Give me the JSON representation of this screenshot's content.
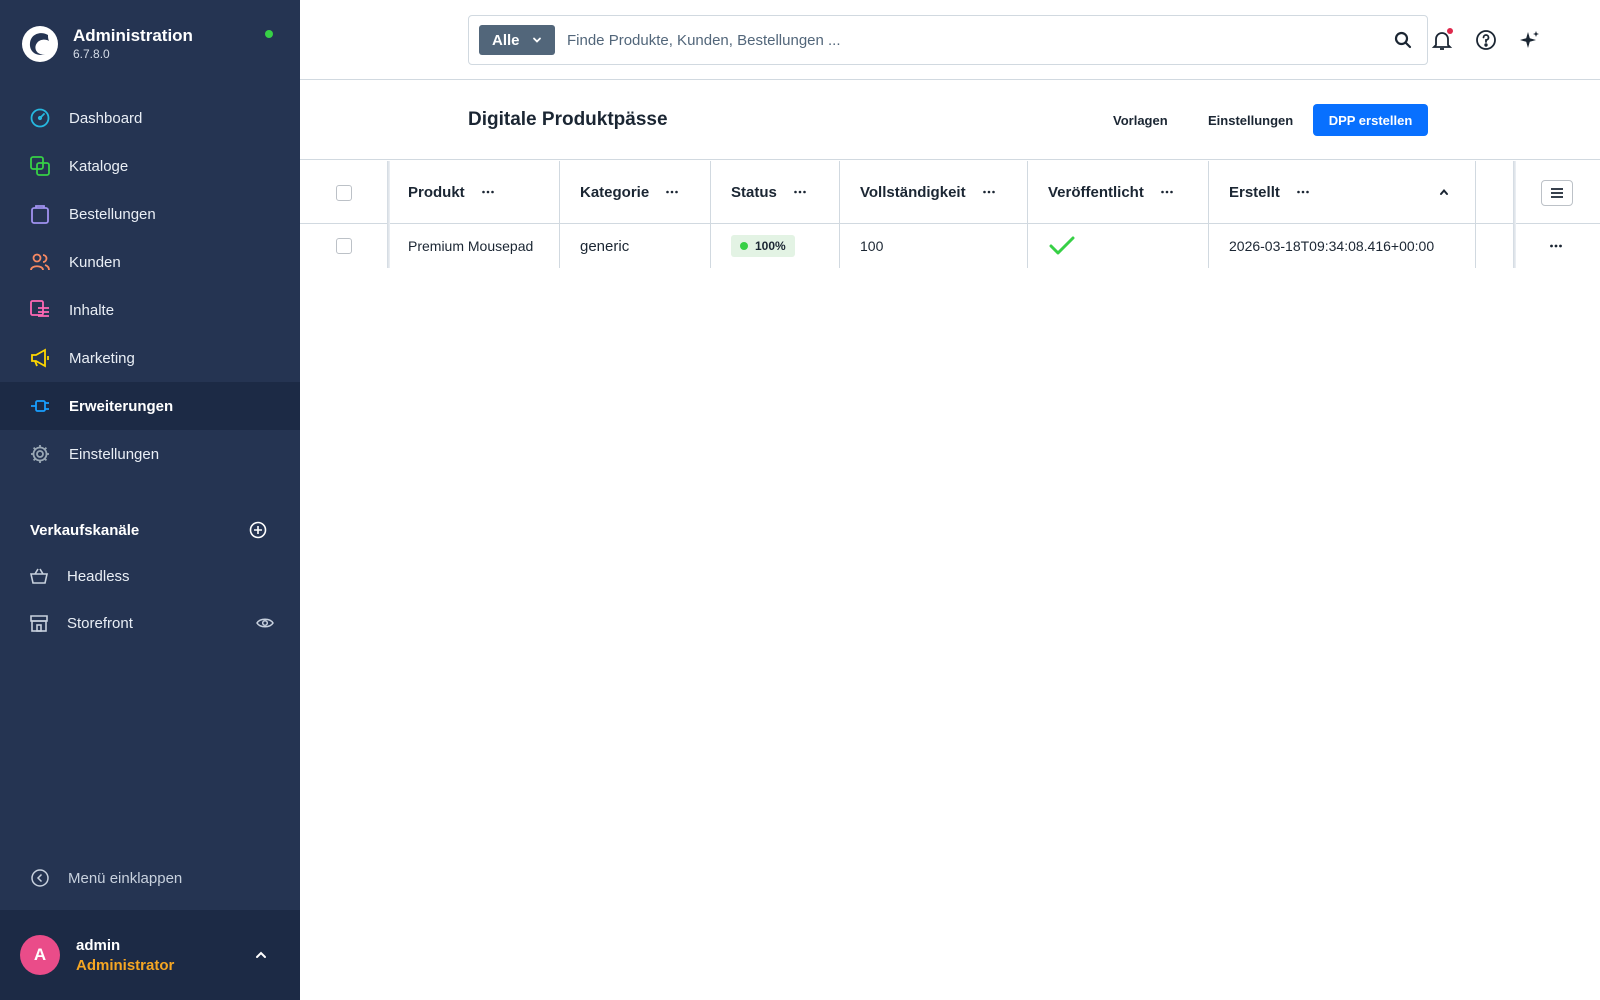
{
  "app": {
    "title": "Administration",
    "version": "6.7.8.0",
    "status_color": "#37d046"
  },
  "sidebar": {
    "items": [
      {
        "label": "Dashboard",
        "icon": "gauge-icon",
        "color": "#26b8e0"
      },
      {
        "label": "Kataloge",
        "icon": "products-icon",
        "color": "#37d046"
      },
      {
        "label": "Bestellungen",
        "icon": "shopping-bag-icon",
        "color": "#a092f0"
      },
      {
        "label": "Kunden",
        "icon": "users-icon",
        "color": "#f88962"
      },
      {
        "label": "Inhalte",
        "icon": "content-icon",
        "color": "#ff68b4"
      },
      {
        "label": "Marketing",
        "icon": "megaphone-icon",
        "color": "#ffd700"
      },
      {
        "label": "Erweiterungen",
        "icon": "plugin-icon",
        "color": "#189eff",
        "active": true
      },
      {
        "label": "Einstellungen",
        "icon": "gear-icon",
        "color": "#9aa8b5"
      }
    ],
    "channels_title": "Verkaufskanäle",
    "channels": [
      {
        "label": "Headless",
        "icon": "basket-icon"
      },
      {
        "label": "Storefront",
        "icon": "storefront-icon"
      }
    ],
    "collapse_label": "Menü einklappen"
  },
  "user": {
    "initial": "A",
    "name": "admin",
    "role": "Administrator",
    "avatar_color": "#ea4c89"
  },
  "search": {
    "type_label": "Alle",
    "placeholder": "Finde Produkte, Kunden, Bestellungen ..."
  },
  "page": {
    "title": "Digitale Produktpässe",
    "templates_label": "Vorlagen",
    "settings_label": "Einstellungen",
    "create_label": "DPP erstellen",
    "accent_color": "#0870ff"
  },
  "grid": {
    "columns": [
      "Produkt",
      "Kategorie",
      "Status",
      "Vollständigkeit",
      "Veröffentlicht",
      "Erstellt"
    ],
    "sorted_column": "Erstellt",
    "sort_direction": "ascending",
    "rows": [
      {
        "produkt": "Premium Mousepad",
        "kategorie": "generic",
        "status": "100%",
        "vollstaendigkeit": "100",
        "veroeffentlicht": true,
        "erstellt": "2026-03-18T09:34:08.416+00:00"
      }
    ]
  }
}
